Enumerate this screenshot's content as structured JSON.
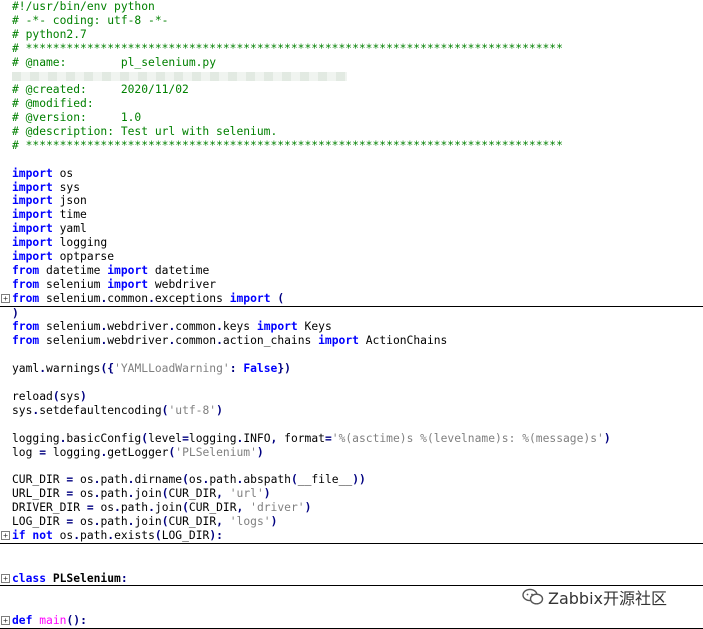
{
  "lines": [
    {
      "t": "#!/usr/bin/env python"
    },
    {
      "t": "# -*- coding: utf-8 -*-"
    },
    {
      "t": "# python2.7"
    },
    {
      "t": "# *******************************************************************************"
    },
    {
      "t": "# @name:        pl_selenium.py"
    },
    {
      "t": ""
    },
    {
      "t": "# @created:     2020/11/02"
    },
    {
      "t": "# @modified:"
    },
    {
      "t": "# @version:     1.0"
    },
    {
      "t": "# @description: Test url with selenium."
    },
    {
      "t": "# *******************************************************************************"
    },
    {
      "t": ""
    },
    {
      "t": "import os"
    },
    {
      "t": "import sys"
    },
    {
      "t": "import json"
    },
    {
      "t": "import time"
    },
    {
      "t": "import yaml"
    },
    {
      "t": "import logging"
    },
    {
      "t": "import optparse"
    },
    {
      "t": "from datetime import datetime"
    },
    {
      "t": "from selenium import webdriver"
    },
    {
      "t": "from selenium.common.exceptions import ("
    },
    {
      "t": ")"
    },
    {
      "t": "from selenium.webdriver.common.keys import Keys"
    },
    {
      "t": "from selenium.webdriver.common.action_chains import ActionChains"
    },
    {
      "t": ""
    },
    {
      "t": "yaml.warnings({'YAMLLoadWarning': False})"
    },
    {
      "t": ""
    },
    {
      "t": "reload(sys)"
    },
    {
      "t": "sys.setdefaultencoding('utf-8')"
    },
    {
      "t": ""
    },
    {
      "t": "logging.basicConfig(level=logging.INFO, format='%(asctime)s %(levelname)s: %(message)s')"
    },
    {
      "t": "log = logging.getLogger('PLSelenium')"
    },
    {
      "t": ""
    },
    {
      "t": "CUR_DIR = os.path.dirname(os.path.abspath(__file__))"
    },
    {
      "t": "URL_DIR = os.path.join(CUR_DIR, 'url')"
    },
    {
      "t": "DRIVER_DIR = os.path.join(CUR_DIR, 'driver')"
    },
    {
      "t": "LOG_DIR = os.path.join(CUR_DIR, 'logs')"
    },
    {
      "t": "if not os.path.exists(LOG_DIR):"
    },
    {
      "t": ""
    },
    {
      "t": ""
    },
    {
      "t": "class PLSelenium:"
    },
    {
      "t": ""
    },
    {
      "t": ""
    },
    {
      "t": "def main():"
    }
  ],
  "fold_markers": [
    21,
    38,
    41,
    44
  ],
  "watermark": {
    "text": "Zabbix开源社区",
    "icon": "wechat-icon"
  },
  "colors": {
    "comment": "#008000",
    "keyword": "#0000ff",
    "string": "#808080",
    "operator": "#000080",
    "function": "#ff00ff"
  }
}
